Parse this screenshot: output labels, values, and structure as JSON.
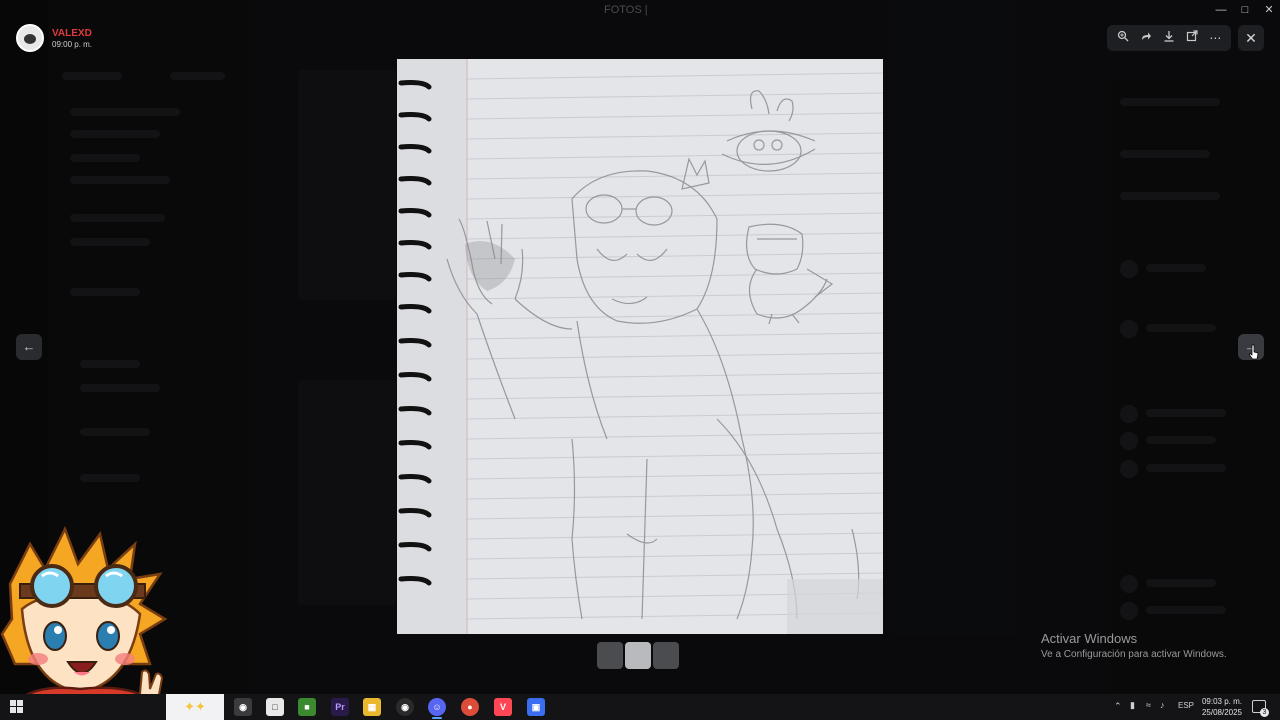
{
  "window": {
    "title": "FOTOS |"
  },
  "viewer": {
    "user_name": "VALEXD",
    "timestamp": "09:00 p. m.",
    "toolbar_icons": [
      "zoom-icon",
      "forward-icon",
      "download-icon",
      "open-external-icon",
      "more-icon"
    ],
    "thumbnails_count": 3,
    "active_thumbnail": 2
  },
  "watermark": {
    "title": "Activar Windows",
    "subtitle": "Ve a Configuración para activar Windows."
  },
  "taskbar": {
    "language": "ESP",
    "time": "09:03 p. m.",
    "date": "25/08/2025",
    "notification_count": "3",
    "apps": [
      {
        "name": "minecraft-icon",
        "color": "#3b8a2f"
      },
      {
        "name": "premiere-icon",
        "color": "#2a1a4a",
        "label": "Pr"
      },
      {
        "name": "explorer-icon",
        "color": "#e9b82c"
      },
      {
        "name": "obs-icon",
        "color": "#2a2a2a"
      },
      {
        "name": "discord-icon",
        "color": "#5865f2"
      },
      {
        "name": "chrome-icon",
        "color": "#dd4b39"
      },
      {
        "name": "valorant-icon",
        "color": "#ff4655"
      },
      {
        "name": "app-icon",
        "color": "#3a6df0"
      }
    ]
  },
  "colors": {
    "username": "#e03b3b",
    "overlay": "#000000"
  }
}
